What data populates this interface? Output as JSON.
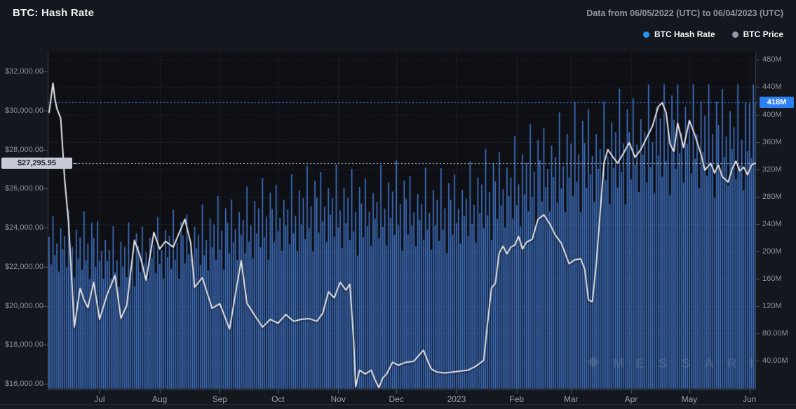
{
  "header": {
    "title": "BTC: Hash Rate",
    "date_range": "Data from 06/05/2022 (UTC) to 06/04/2023 (UTC)"
  },
  "legend": {
    "items": [
      {
        "label": "BTC Hash Rate",
        "color": "#2596f5"
      },
      {
        "label": "BTC Price",
        "color": "#939aa9"
      }
    ]
  },
  "watermark": {
    "text": "MESSARI"
  },
  "current": {
    "price_label": "$27,295.95",
    "price_value": 27295.95,
    "price_badge_bg": "#c7cad7",
    "hash_label": "418M",
    "hash_value": 418,
    "hash_badge_bg": "#2d7ff2"
  },
  "axes": {
    "left": {
      "unit": "USD",
      "min": 16000,
      "max": 32000,
      "ticks": [
        {
          "label": "$32,000.00",
          "value": 32000
        },
        {
          "label": "$30,000.00",
          "value": 30000
        },
        {
          "label": "$28,000.00",
          "value": 28000
        },
        {
          "label": "$26,000.00",
          "value": 26000
        },
        {
          "label": "$24,000.00",
          "value": 24000
        },
        {
          "label": "$22,000.00",
          "value": 22000
        },
        {
          "label": "$20,000.00",
          "value": 20000
        },
        {
          "label": "$18,000.00",
          "value": 18000
        },
        {
          "label": "$16,000.00",
          "value": 16000
        }
      ]
    },
    "right": {
      "unit": "hash rate (TH/s, millions)",
      "min": 0,
      "max": 480,
      "ticks": [
        {
          "label": "480M",
          "value": 480
        },
        {
          "label": "440M",
          "value": 440
        },
        {
          "label": "400M",
          "value": 400
        },
        {
          "label": "360M",
          "value": 360
        },
        {
          "label": "320M",
          "value": 320
        },
        {
          "label": "280M",
          "value": 280
        },
        {
          "label": "240M",
          "value": 240
        },
        {
          "label": "200M",
          "value": 200
        },
        {
          "label": "160M",
          "value": 160
        },
        {
          "label": "120M",
          "value": 120
        },
        {
          "label": "80.00M",
          "value": 80
        },
        {
          "label": "40.00M",
          "value": 40
        }
      ]
    },
    "x": {
      "start": "06/05/2022",
      "end": "06/04/2023",
      "days": 365,
      "ticks": [
        {
          "label": "Jul",
          "day": 26
        },
        {
          "label": "Aug",
          "day": 57
        },
        {
          "label": "Sep",
          "day": 88
        },
        {
          "label": "Oct",
          "day": 118
        },
        {
          "label": "Nov",
          "day": 149
        },
        {
          "label": "Dec",
          "day": 179
        },
        {
          "label": "2023",
          "day": 210
        },
        {
          "label": "Feb",
          "day": 241
        },
        {
          "label": "Mar",
          "day": 269
        },
        {
          "label": "Apr",
          "day": 300
        },
        {
          "label": "May",
          "day": 330
        },
        {
          "label": "Jun",
          "day": 361
        }
      ]
    }
  },
  "chart_data": {
    "type": "bar+line",
    "x_range": {
      "start": "06/05/2022",
      "end": "06/04/2023",
      "days": 365
    },
    "series": [
      {
        "name": "BTC Hash Rate",
        "type": "bar",
        "unit": "M TH/s",
        "color": "#4379cf",
        "axis": "right",
        "last_value": 418,
        "max_clamp": 444,
        "anchors": [
          [
            0,
            205
          ],
          [
            8,
            210
          ],
          [
            15,
            200
          ],
          [
            22,
            205
          ],
          [
            28,
            195
          ],
          [
            35,
            185
          ],
          [
            42,
            190
          ],
          [
            50,
            195
          ],
          [
            58,
            200
          ],
          [
            66,
            205
          ],
          [
            74,
            210
          ],
          [
            82,
            215
          ],
          [
            90,
            222
          ],
          [
            98,
            230
          ],
          [
            106,
            238
          ],
          [
            114,
            242
          ],
          [
            122,
            246
          ],
          [
            130,
            252
          ],
          [
            138,
            258
          ],
          [
            146,
            262
          ],
          [
            152,
            255
          ],
          [
            158,
            248
          ],
          [
            164,
            252
          ],
          [
            170,
            258
          ],
          [
            176,
            262
          ],
          [
            182,
            258
          ],
          [
            188,
            252
          ],
          [
            194,
            256
          ],
          [
            200,
            250
          ],
          [
            206,
            254
          ],
          [
            212,
            258
          ],
          [
            218,
            264
          ],
          [
            224,
            272
          ],
          [
            230,
            280
          ],
          [
            236,
            288
          ],
          [
            242,
            295
          ],
          [
            248,
            302
          ],
          [
            254,
            310
          ],
          [
            260,
            318
          ],
          [
            266,
            322
          ],
          [
            272,
            328
          ],
          [
            278,
            334
          ],
          [
            284,
            330
          ],
          [
            290,
            338
          ],
          [
            296,
            344
          ],
          [
            302,
            348
          ],
          [
            308,
            354
          ],
          [
            314,
            358
          ],
          [
            320,
            362
          ],
          [
            326,
            366
          ],
          [
            332,
            370
          ],
          [
            338,
            362
          ],
          [
            344,
            355
          ],
          [
            350,
            362
          ],
          [
            356,
            358
          ],
          [
            360,
            365
          ],
          [
            364,
            418
          ]
        ],
        "daily_variation_pattern": [
          0.08,
          -0.12,
          0.22,
          -0.06,
          0.02,
          -0.18,
          0.12,
          -0.03,
          0.06,
          -0.15,
          0.26,
          -0.09,
          0.01,
          -0.2,
          0.15,
          -0.05,
          0.1,
          -0.14,
          0.28,
          -0.08,
          0.04,
          -0.22,
          0.18
        ]
      },
      {
        "name": "BTC Price",
        "type": "line",
        "unit": "USD",
        "color": "#e7e9ee",
        "axis": "left",
        "last_value": 27295.95,
        "anchors": [
          [
            0,
            29900
          ],
          [
            2,
            31400
          ],
          [
            3,
            30600
          ],
          [
            4,
            30100
          ],
          [
            6,
            29600
          ],
          [
            8,
            26500
          ],
          [
            10,
            24300
          ],
          [
            13,
            18900
          ],
          [
            16,
            20900
          ],
          [
            18,
            20300
          ],
          [
            20,
            19900
          ],
          [
            23,
            21200
          ],
          [
            26,
            19300
          ],
          [
            30,
            20600
          ],
          [
            34,
            21550
          ],
          [
            37,
            19350
          ],
          [
            40,
            20000
          ],
          [
            44,
            23350
          ],
          [
            47,
            22500
          ],
          [
            50,
            21300
          ],
          [
            54,
            23760
          ],
          [
            57,
            22900
          ],
          [
            60,
            23300
          ],
          [
            64,
            23000
          ],
          [
            70,
            24430
          ],
          [
            73,
            23200
          ],
          [
            75,
            20950
          ],
          [
            79,
            21430
          ],
          [
            84,
            19870
          ],
          [
            88,
            20100
          ],
          [
            93,
            18800
          ],
          [
            99,
            22320
          ],
          [
            102,
            20120
          ],
          [
            106,
            19500
          ],
          [
            110,
            18900
          ],
          [
            114,
            19300
          ],
          [
            118,
            19100
          ],
          [
            122,
            19550
          ],
          [
            126,
            19200
          ],
          [
            130,
            19300
          ],
          [
            134,
            19340
          ],
          [
            138,
            19200
          ],
          [
            141,
            19600
          ],
          [
            144,
            20710
          ],
          [
            147,
            20400
          ],
          [
            150,
            21200
          ],
          [
            153,
            20800
          ],
          [
            155,
            21100
          ],
          [
            157,
            18200
          ],
          [
            158,
            15850
          ],
          [
            160,
            16700
          ],
          [
            163,
            16500
          ],
          [
            166,
            16700
          ],
          [
            168,
            16200
          ],
          [
            170,
            15800
          ],
          [
            172,
            16300
          ],
          [
            174,
            16500
          ],
          [
            177,
            17100
          ],
          [
            180,
            16950
          ],
          [
            184,
            17100
          ],
          [
            188,
            17150
          ],
          [
            191,
            17500
          ],
          [
            193,
            17720
          ],
          [
            195,
            17200
          ],
          [
            197,
            16750
          ],
          [
            200,
            16600
          ],
          [
            204,
            16550
          ],
          [
            208,
            16600
          ],
          [
            212,
            16650
          ],
          [
            216,
            16700
          ],
          [
            220,
            16900
          ],
          [
            224,
            17200
          ],
          [
            226,
            19100
          ],
          [
            228,
            20900
          ],
          [
            230,
            21150
          ],
          [
            232,
            22700
          ],
          [
            234,
            23050
          ],
          [
            236,
            22650
          ],
          [
            238,
            23000
          ],
          [
            240,
            23100
          ],
          [
            242,
            23550
          ],
          [
            244,
            22900
          ],
          [
            246,
            23250
          ],
          [
            249,
            23400
          ],
          [
            252,
            24430
          ],
          [
            255,
            24650
          ],
          [
            258,
            24200
          ],
          [
            261,
            23600
          ],
          [
            264,
            23200
          ],
          [
            268,
            22150
          ],
          [
            271,
            22350
          ],
          [
            274,
            22400
          ],
          [
            276,
            21900
          ],
          [
            278,
            20300
          ],
          [
            280,
            20200
          ],
          [
            282,
            22100
          ],
          [
            284,
            24750
          ],
          [
            286,
            27300
          ],
          [
            288,
            28000
          ],
          [
            290,
            27700
          ],
          [
            293,
            27300
          ],
          [
            296,
            27800
          ],
          [
            299,
            28350
          ],
          [
            302,
            27600
          ],
          [
            305,
            28000
          ],
          [
            308,
            28600
          ],
          [
            311,
            29200
          ],
          [
            314,
            30200
          ],
          [
            316,
            30400
          ],
          [
            318,
            29900
          ],
          [
            320,
            28300
          ],
          [
            322,
            27900
          ],
          [
            324,
            29350
          ],
          [
            327,
            28100
          ],
          [
            330,
            29490
          ],
          [
            333,
            28700
          ],
          [
            336,
            27760
          ],
          [
            338,
            26940
          ],
          [
            341,
            27300
          ],
          [
            343,
            26800
          ],
          [
            345,
            27200
          ],
          [
            347,
            26600
          ],
          [
            350,
            26330
          ],
          [
            352,
            27000
          ],
          [
            354,
            27400
          ],
          [
            356,
            26900
          ],
          [
            358,
            27100
          ],
          [
            360,
            26700
          ],
          [
            362,
            27200
          ],
          [
            364,
            27296
          ]
        ]
      }
    ],
    "legend_position": "top-right",
    "grid": "horizontal-dashed"
  },
  "colors": {
    "page_bg": "#15171e",
    "plot_bg": "#0e1016",
    "grid": "#272b34",
    "axis_line": "#3c4049",
    "tick_mark": "#565b66",
    "bar": "#4379cf",
    "price_line": "#e7e9ee",
    "hash_dotted_line": "#3f87ff",
    "price_dotted_line": "#c9cdd8",
    "watermark": "rgba(205,211,223,0.16)"
  }
}
